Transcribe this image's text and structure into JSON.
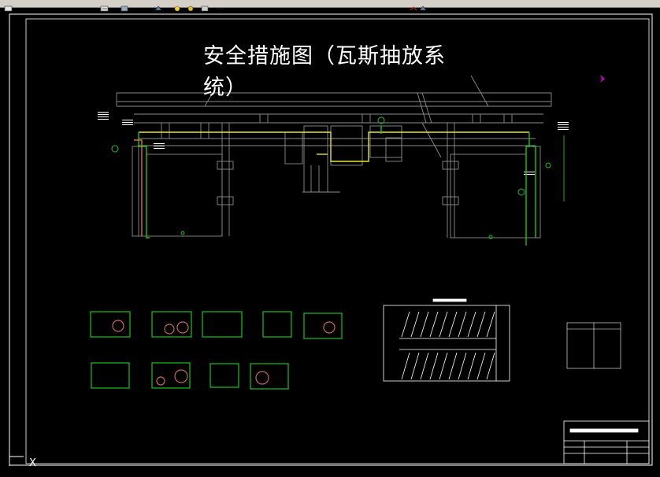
{
  "toolbar": {
    "icons": [
      "layer-icon",
      "properties-icon",
      "cube-icon",
      "bulb-icon",
      "sun-icon",
      "lock-icon",
      "color-icon",
      "linetype-icon",
      "lineweight-icon"
    ]
  },
  "drawing": {
    "title_line1": "安全措施图（瓦斯抽放系",
    "title_line2": "统）",
    "ucs_x_label": "X",
    "colors": {
      "frame": "#ffffff",
      "tunnel": "#8c8c8c",
      "green_pipe": "#18c418",
      "yellow_pipe": "#e6e633",
      "orange_pipe": "#d27822",
      "magenta_marker": "#c000c0"
    }
  }
}
